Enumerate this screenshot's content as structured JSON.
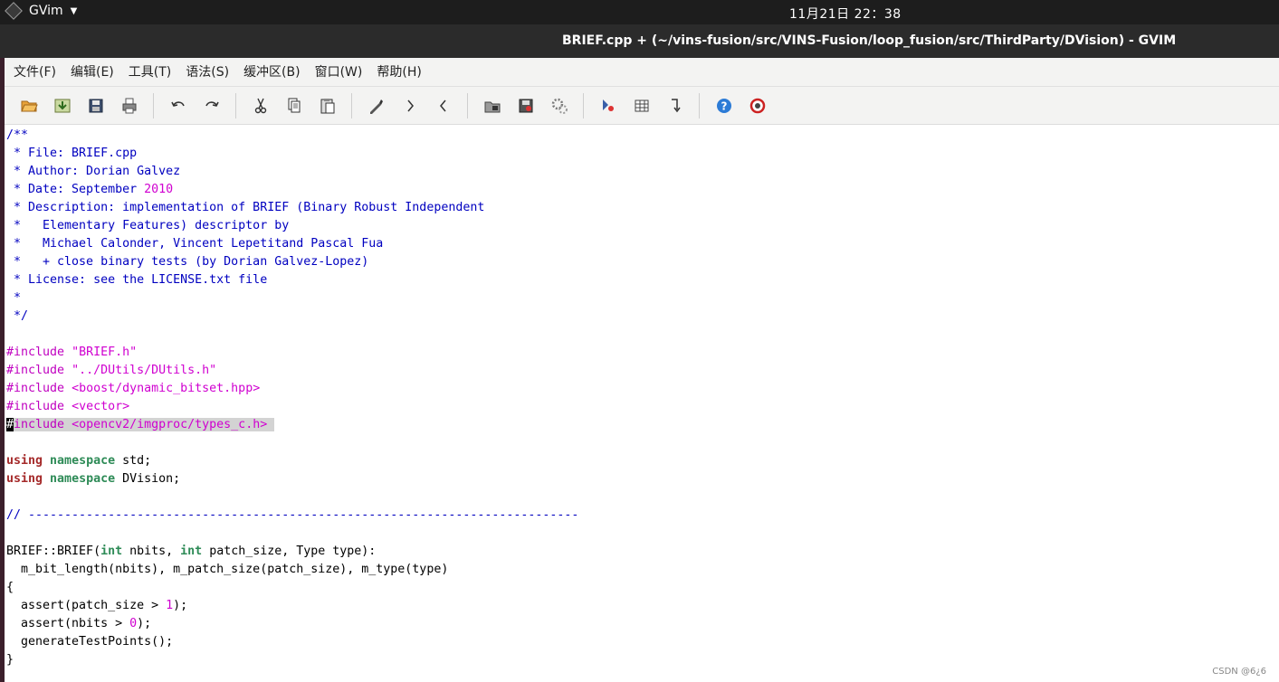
{
  "system": {
    "app_name": "GVim",
    "clock": "11月21日  22：38"
  },
  "window": {
    "title": "BRIEF.cpp + (~/vins-fusion/src/VINS-Fusion/loop_fusion/src/ThirdParty/DVision) - GVIM"
  },
  "menu": [
    "文件(F)",
    "编辑(E)",
    "工具(T)",
    "语法(S)",
    "缓冲区(B)",
    "窗口(W)",
    "帮助(H)"
  ],
  "toolbar": {
    "groups": [
      [
        "open-icon",
        "save-session-icon",
        "save-icon",
        "print-icon"
      ],
      [
        "undo-icon",
        "redo-icon"
      ],
      [
        "cut-icon",
        "copy-icon",
        "paste-icon"
      ],
      [
        "find-replace-icon",
        "find-next-icon",
        "find-prev-icon"
      ],
      [
        "load-session-icon",
        "save-session-file-icon",
        "run-script-icon"
      ],
      [
        "make-icon",
        "ctags-icon",
        "jump-tag-icon"
      ],
      [
        "help-icon",
        "find-help-icon"
      ]
    ]
  },
  "editor": {
    "lines": [
      [
        [
          "c-comment",
          "/**"
        ]
      ],
      [
        [
          "c-comment",
          " * File: BRIEF.cpp"
        ]
      ],
      [
        [
          "c-comment",
          " * Author: Dorian Galvez"
        ]
      ],
      [
        [
          "c-comment",
          " * Date: September "
        ],
        [
          "c-num",
          "2010"
        ]
      ],
      [
        [
          "c-comment",
          " * Description: implementation of BRIEF (Binary Robust Independent"
        ]
      ],
      [
        [
          "c-comment",
          " *   Elementary Features) descriptor by"
        ]
      ],
      [
        [
          "c-comment",
          " *   Michael Calonder, Vincent Lepetitand Pascal Fua"
        ]
      ],
      [
        [
          "c-comment",
          " *   + close binary tests (by Dorian Galvez-Lopez)"
        ]
      ],
      [
        [
          "c-comment",
          " * License: see the LICENSE.txt file"
        ]
      ],
      [
        [
          "c-comment",
          " *"
        ]
      ],
      [
        [
          "c-comment",
          " */"
        ]
      ],
      [
        [
          "",
          ""
        ]
      ],
      [
        [
          "c-pre",
          "#include "
        ],
        [
          "c-str",
          "\"BRIEF.h\""
        ]
      ],
      [
        [
          "c-pre",
          "#include "
        ],
        [
          "c-str",
          "\"../DUtils/DUtils.h\""
        ]
      ],
      [
        [
          "c-pre",
          "#include "
        ],
        [
          "c-str",
          "<boost/dynamic_bitset.hpp>"
        ]
      ],
      [
        [
          "c-pre",
          "#include "
        ],
        [
          "c-str",
          "<vector>"
        ]
      ],
      [
        [
          "cursor",
          "#"
        ],
        [
          "c-pre hl",
          "include "
        ],
        [
          "c-str hl",
          "<opencv2/imgproc/types_c.h> "
        ]
      ],
      [
        [
          "",
          ""
        ]
      ],
      [
        [
          "c-kw",
          "using"
        ],
        [
          "",
          " "
        ],
        [
          "c-type",
          "namespace"
        ],
        [
          "",
          " std;"
        ]
      ],
      [
        [
          "c-kw",
          "using"
        ],
        [
          "",
          " "
        ],
        [
          "c-type",
          "namespace"
        ],
        [
          "",
          " DVision;"
        ]
      ],
      [
        [
          "",
          ""
        ]
      ],
      [
        [
          "c-comment",
          "// ----------------------------------------------------------------------------"
        ]
      ],
      [
        [
          "",
          ""
        ]
      ],
      [
        [
          "",
          "BRIEF::BRIEF("
        ],
        [
          "c-type",
          "int"
        ],
        [
          "",
          " nbits, "
        ],
        [
          "c-type",
          "int"
        ],
        [
          "",
          " patch_size, Type type):"
        ]
      ],
      [
        [
          "",
          "  m_bit_length(nbits), m_patch_size(patch_size), m_type(type)"
        ]
      ],
      [
        [
          "",
          "{"
        ]
      ],
      [
        [
          "",
          "  assert(patch_size > "
        ],
        [
          "c-num",
          "1"
        ],
        [
          "",
          ");"
        ]
      ],
      [
        [
          "",
          "  assert(nbits > "
        ],
        [
          "c-num",
          "0"
        ],
        [
          "",
          ");"
        ]
      ],
      [
        [
          "",
          "  generateTestPoints();"
        ]
      ],
      [
        [
          "",
          "}"
        ]
      ]
    ]
  },
  "watermark": "CSDN @6¿6"
}
